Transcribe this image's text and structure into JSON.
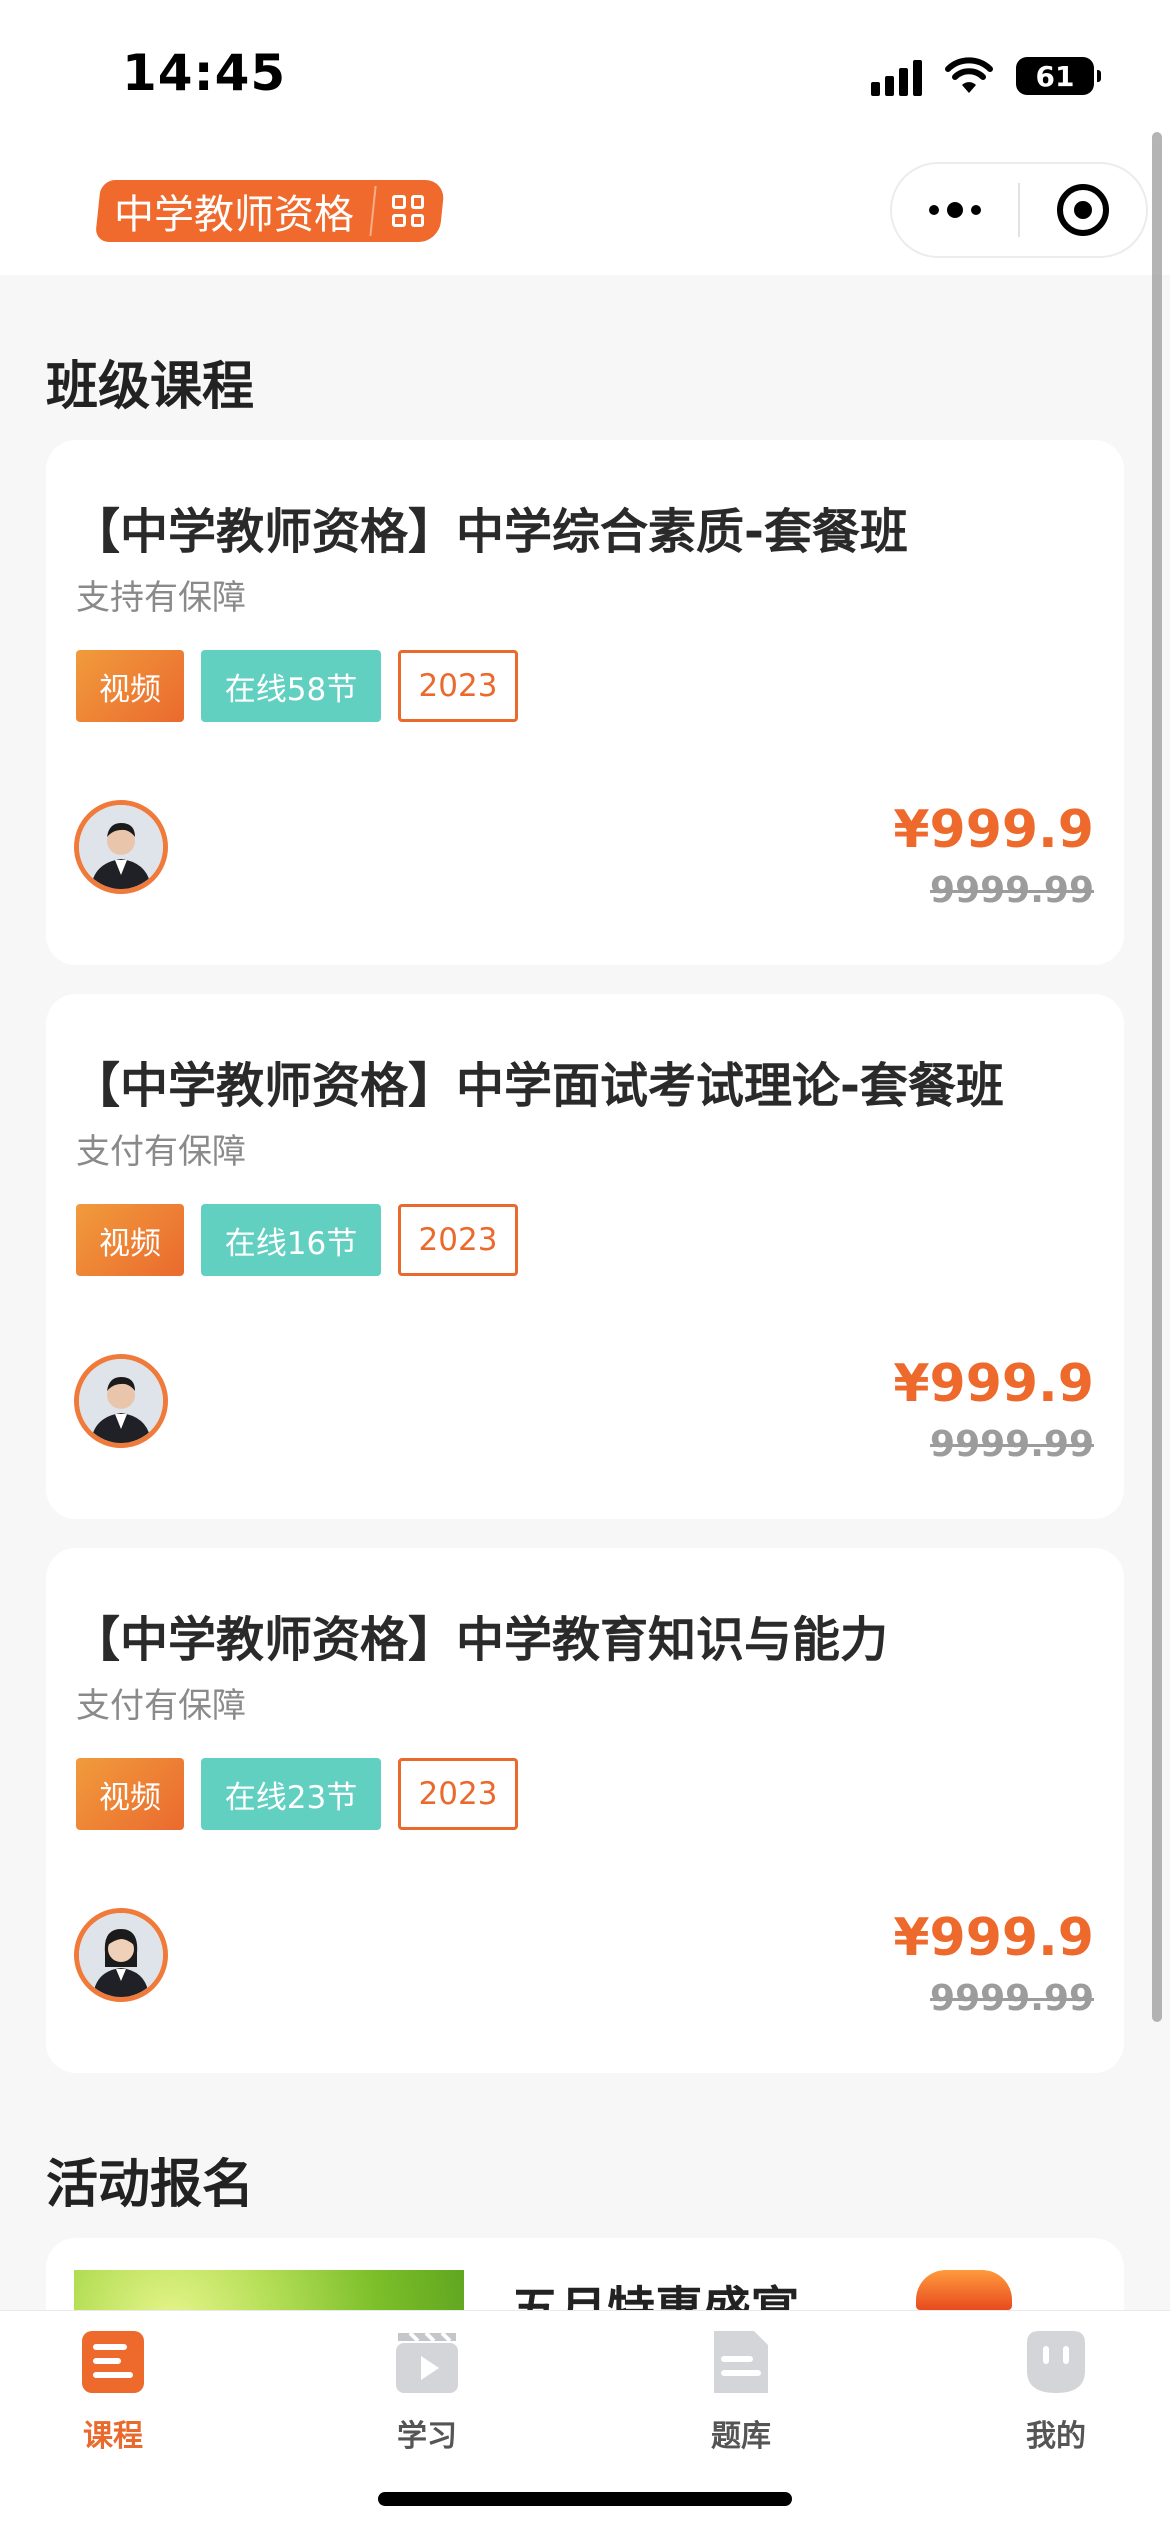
{
  "status_bar": {
    "time": "14:45",
    "battery": "61",
    "icons": [
      "signal-icon",
      "wifi-icon",
      "battery-icon"
    ]
  },
  "header": {
    "brand": "中学教师资格",
    "brand_icon": "grid-icon",
    "capsule_icons": [
      "more-dots-icon",
      "close-target-icon"
    ]
  },
  "colors": {
    "accent": "#EE6A2C",
    "teal": "#62D0C1",
    "background": "#F7F7F7"
  },
  "sections": {
    "courses_title": "班级课程",
    "activity_title": "活动报名"
  },
  "courses": [
    {
      "title": "【中学教师资格】中学综合素质-套餐班",
      "subtitle": "支持有保障",
      "tag_video": "视频",
      "tag_online": "在线58节",
      "tag_year": "2023",
      "price": "¥999.9",
      "original_price": "9999.99",
      "avatar": "male-teacher-avatar"
    },
    {
      "title": "【中学教师资格】中学面试考试理论-套餐班",
      "subtitle": "支付有保障",
      "tag_video": "视频",
      "tag_online": "在线16节",
      "tag_year": "2023",
      "price": "¥999.9",
      "original_price": "9999.99",
      "avatar": "male-teacher-avatar"
    },
    {
      "title": "【中学教师资格】中学教育知识与能力",
      "subtitle": "支付有保障",
      "tag_video": "视频",
      "tag_online": "在线23节",
      "tag_year": "2023",
      "price": "¥999.9",
      "original_price": "9999.99",
      "avatar": "female-teacher-avatar"
    }
  ],
  "activity": {
    "title": "五月特惠盛宴"
  },
  "tabbar": {
    "items": [
      {
        "label": "课程",
        "icon": "course-icon",
        "active": true
      },
      {
        "label": "学习",
        "icon": "video-play-icon",
        "active": false
      },
      {
        "label": "题库",
        "icon": "document-icon",
        "active": false
      },
      {
        "label": "我的",
        "icon": "profile-icon",
        "active": false
      }
    ]
  }
}
